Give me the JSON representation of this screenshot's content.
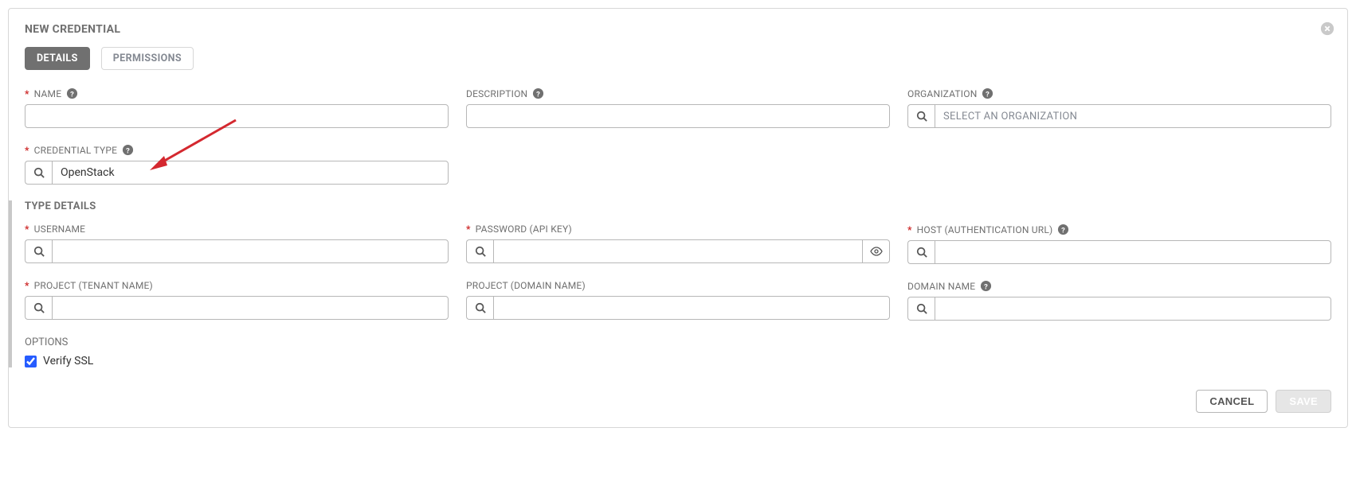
{
  "panel_title": "NEW CREDENTIAL",
  "tabs": {
    "details": "DETAILS",
    "permissions": "PERMISSIONS"
  },
  "fields": {
    "name_label": "NAME",
    "description_label": "DESCRIPTION",
    "organization_label": "ORGANIZATION",
    "organization_placeholder": "SELECT AN ORGANIZATION",
    "credential_type_label": "CREDENTIAL TYPE",
    "credential_type_value": "OpenStack"
  },
  "section_title": "TYPE DETAILS",
  "type_details": {
    "username_label": "USERNAME",
    "password_label": "PASSWORD (API KEY)",
    "host_label": "HOST (AUTHENTICATION URL)",
    "project_tenant_label": "PROJECT (TENANT NAME)",
    "project_domain_label": "PROJECT (DOMAIN NAME)",
    "domain_name_label": "DOMAIN NAME"
  },
  "options": {
    "heading": "OPTIONS",
    "verify_ssl_label": "Verify SSL",
    "verify_ssl_checked": true
  },
  "footer": {
    "cancel": "CANCEL",
    "save": "SAVE"
  }
}
